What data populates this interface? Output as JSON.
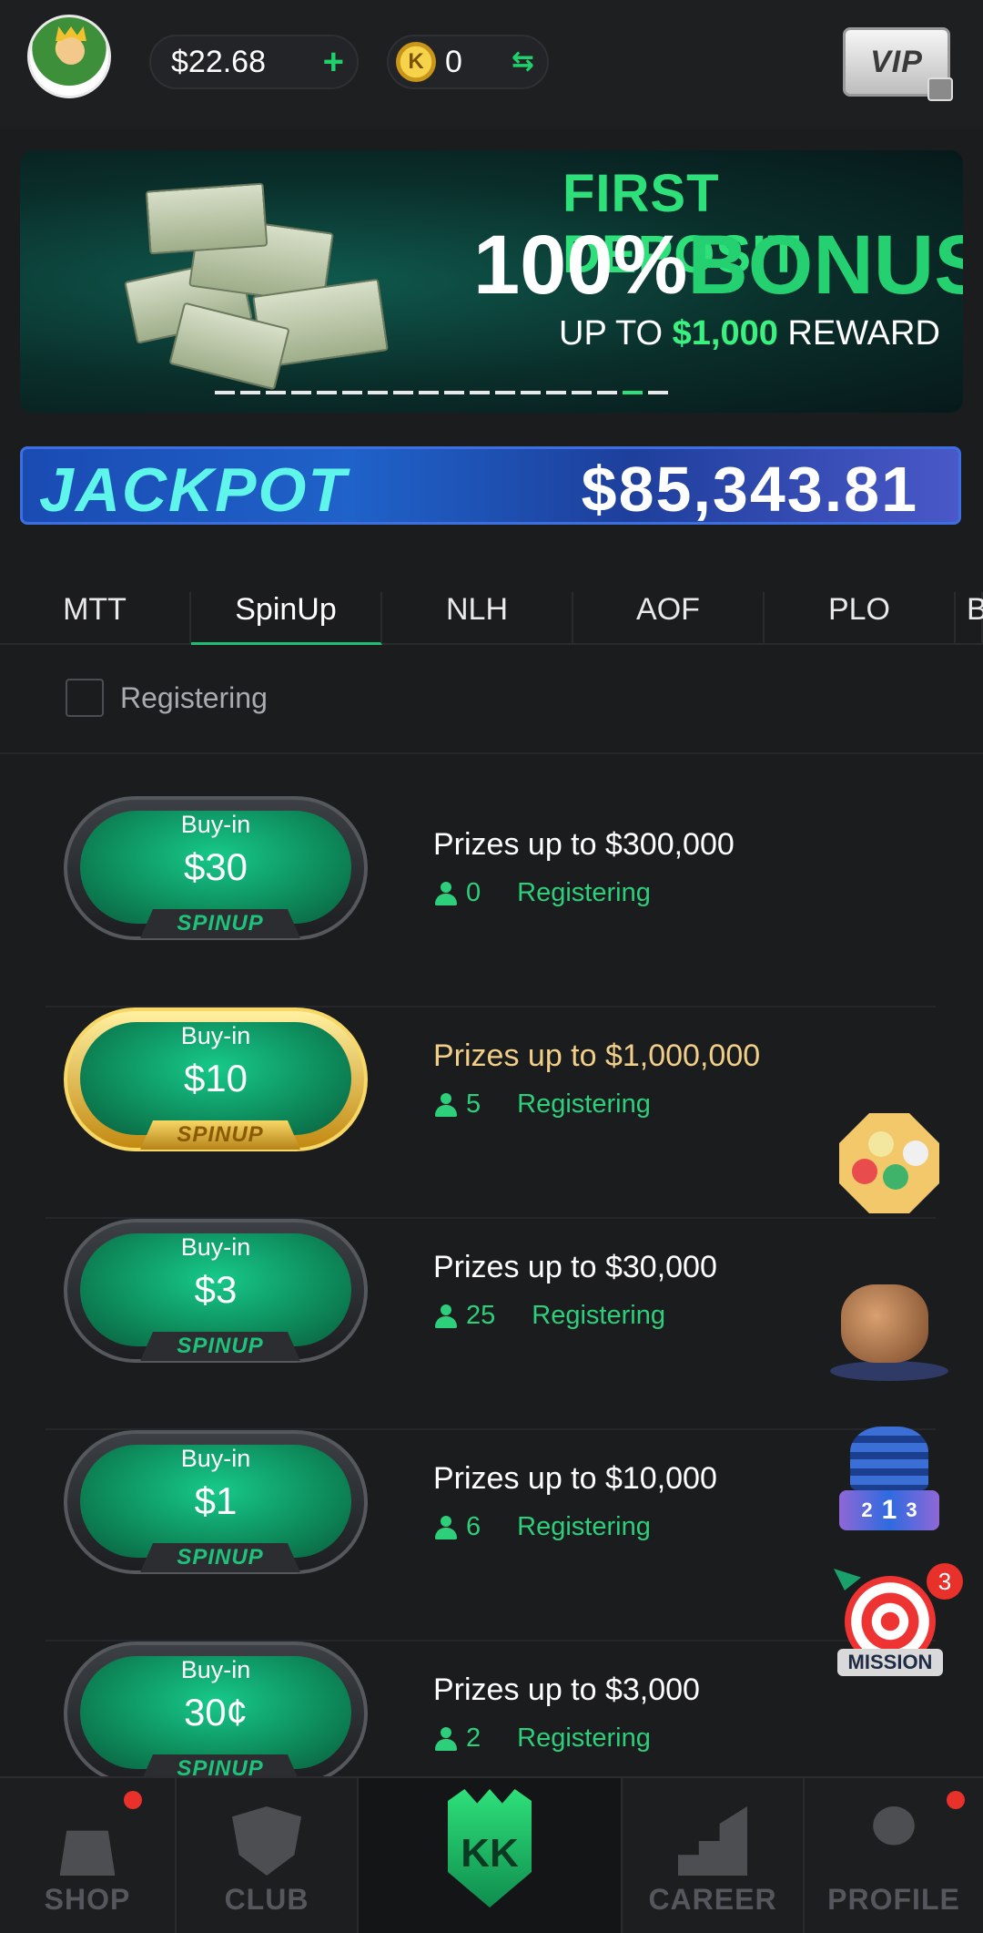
{
  "header": {
    "balance": "$22.68",
    "coins": "0",
    "coin_symbol": "K",
    "vip_label": "VIP"
  },
  "banner": {
    "line1": "FIRST DEPOSIT",
    "line2_pct": "100%",
    "line2_word": "BONUS",
    "line3_prefix": "UP TO ",
    "line3_amount": "$1,000",
    "line3_suffix": " REWARD",
    "slides_total": 18,
    "slide_active_index": 16
  },
  "jackpot": {
    "label": "JACKPOT",
    "value": "$85,343.81"
  },
  "tabs": [
    "MTT",
    "SpinUp",
    "NLH",
    "AOF",
    "PLO",
    "B"
  ],
  "active_tab": "SpinUp",
  "filter": {
    "label": "Registering",
    "checked": false
  },
  "games": [
    {
      "label": "Buy-in",
      "buyin": "$30",
      "tag": "SPINUP",
      "prize": "Prizes up to $300,000",
      "players": "0",
      "status": "Registering",
      "gold": false
    },
    {
      "label": "Buy-in",
      "buyin": "$10",
      "tag": "SPINUP",
      "prize": "Prizes up to $1,000,000",
      "players": "5",
      "status": "Registering",
      "gold": true
    },
    {
      "label": "Buy-in",
      "buyin": "$3",
      "tag": "SPINUP",
      "prize": "Prizes up to $30,000",
      "players": "25",
      "status": "Registering",
      "gold": false
    },
    {
      "label": "Buy-in",
      "buyin": "$1",
      "tag": "SPINUP",
      "prize": "Prizes up to $10,000",
      "players": "6",
      "status": "Registering",
      "gold": false
    },
    {
      "label": "Buy-in",
      "buyin": "30¢",
      "tag": "SPINUP",
      "prize": "Prizes up to $3,000",
      "players": "2",
      "status": "Registering",
      "gold": false
    }
  ],
  "floating": {
    "rank_number": "1",
    "rank_left": "2",
    "rank_right": "3",
    "mission_label": "MISSION",
    "mission_badge": "3"
  },
  "nav": {
    "shop": "SHOP",
    "club": "CLUB",
    "home_logo": "KK",
    "career": "CAREER",
    "profile": "PROFILE"
  },
  "colors": {
    "accent_green": "#2ecf7b",
    "jackpot_blue": "#1f62c9",
    "badge_red": "#e8312a",
    "gold_prize": "#f2cf88"
  },
  "icons": [
    "avatar-king",
    "plus-icon",
    "coin-icon",
    "swap-icon",
    "vip-lock-icon",
    "person-icon",
    "shop-bag-icon",
    "club-shield-icon",
    "kk-logo-icon",
    "career-chart-icon",
    "profile-person-icon"
  ]
}
